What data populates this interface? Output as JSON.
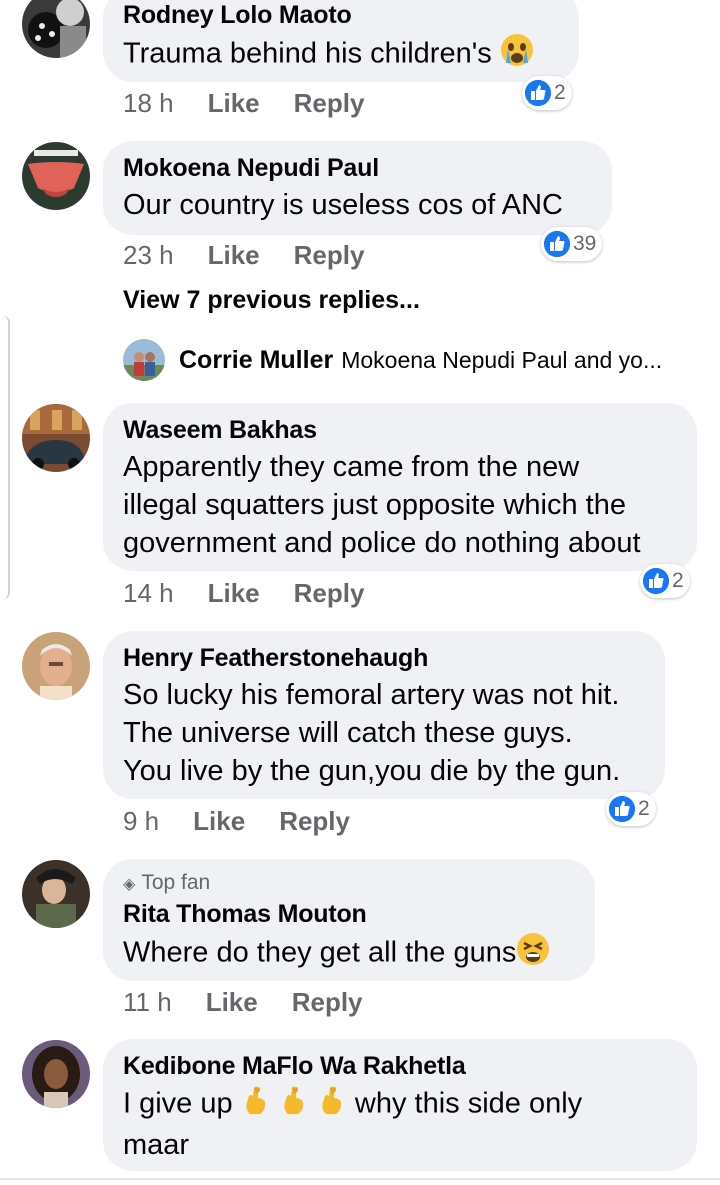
{
  "comments": [
    {
      "name": "Rodney Lolo Maoto",
      "text": "Trauma behind his children's",
      "time": "18 h",
      "like": "Like",
      "reply": "Reply",
      "reactions": "2"
    },
    {
      "name": "Mokoena Nepudi Paul",
      "text": "Our country is useless cos of ANC",
      "time": "23 h",
      "like": "Like",
      "reply": "Reply",
      "reactions": "39"
    },
    {
      "name": "Waseem Bakhas",
      "text_lines": [
        "Apparently they came from the new",
        "illegal squatters just opposite which the",
        "government and police do nothing about"
      ],
      "time": "14 h",
      "like": "Like",
      "reply": "Reply",
      "reactions": "2"
    },
    {
      "name": "Henry Featherstonehaugh",
      "text_lines": [
        "So lucky his femoral artery was not hit.",
        "The universe will catch these guys.",
        "You live by the gun,you die by the gun."
      ],
      "time": "9 h",
      "like": "Like",
      "reply": "Reply",
      "reactions": "2"
    },
    {
      "badge": "Top fan",
      "name": "Rita Thomas Mouton",
      "text": "Where do they get all the guns",
      "time": "11 h",
      "like": "Like",
      "reply": "Reply"
    },
    {
      "name": "Kedibone MaFlo Wa Rakhetla",
      "text_part1": "I give up",
      "text_part2": "why this side only",
      "text_line2": "maar"
    }
  ],
  "view_previous": "View 7 previous replies...",
  "reply_preview": {
    "name": "Corrie Muller",
    "text": "Mokoena Nepudi Paul and yo..."
  },
  "colors": {
    "bubble": "#eff1f4",
    "like_blue": "#1877f2",
    "meta_gray": "#65676b"
  }
}
